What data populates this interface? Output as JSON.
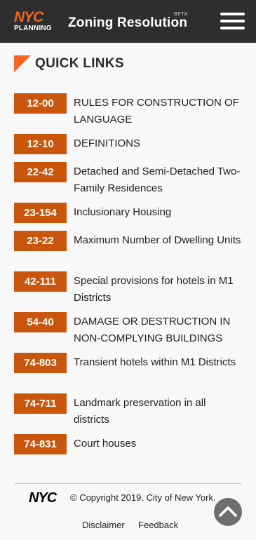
{
  "header": {
    "logo_top": "NYC",
    "logo_bottom": "PLANNING",
    "title": "Zoning Resolution",
    "badge": "BETA",
    "menu_icon": "hamburger-menu-icon"
  },
  "quick_links": {
    "title": "QUICK LINKS",
    "items": [
      {
        "code": "12-00",
        "label": "RULES FOR CONSTRUCTION OF LANGUAGE"
      },
      {
        "code": "12-10",
        "label": "DEFINITIONS"
      },
      {
        "code": "22-42",
        "label": "Detached and Semi-Detached Two-Family Residences"
      },
      {
        "code": "23-154",
        "label": "Inclusionary Housing"
      },
      {
        "code": "23-22",
        "label": "Maximum Number of Dwelling Units"
      },
      {
        "code": "42-111",
        "label": "Special provisions for hotels in M1 Districts"
      },
      {
        "code": "54-40",
        "label": "DAMAGE OR DESTRUCTION IN NON-COMPLYING BUILDINGS"
      },
      {
        "code": "74-803",
        "label": "Transient hotels within M1 Districts"
      },
      {
        "code": "74-711",
        "label": "Landmark preservation in all districts"
      },
      {
        "code": "74-831",
        "label": "Court houses"
      }
    ]
  },
  "footer": {
    "nyc_logo": "NYC",
    "copyright": "© Copyright 2019. City of New York.",
    "disclaimer": "Disclaimer",
    "feedback": "Feedback",
    "scroll_top_icon": "chevron-up-icon"
  },
  "colors": {
    "header_bg": "#2e2e2e",
    "accent": "#c9560c",
    "logo_orange": "#f26522"
  }
}
